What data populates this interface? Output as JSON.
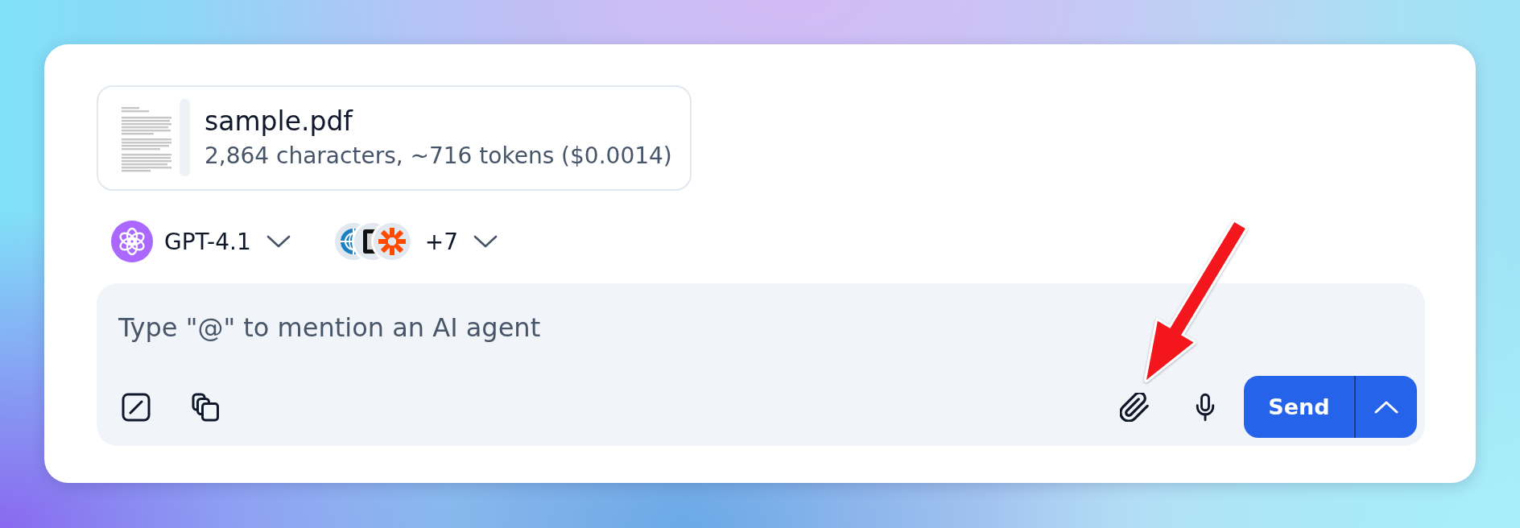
{
  "attachment": {
    "file_name": "sample.pdf",
    "details": "2,864 characters, ~716 tokens ($0.0014)"
  },
  "model_selector": {
    "label": "GPT-4.1"
  },
  "agents_selector": {
    "more_count": "+7"
  },
  "composer": {
    "placeholder": "Type \"@\" to mention an AI agent"
  },
  "send_button": {
    "label": "Send"
  }
}
